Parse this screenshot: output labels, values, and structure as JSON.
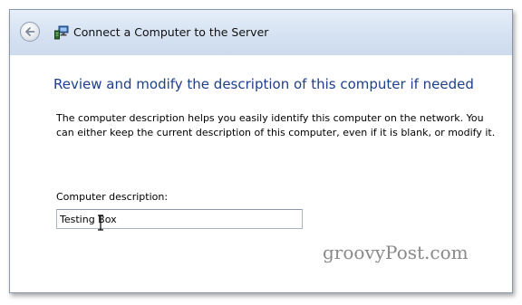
{
  "window": {
    "title": "Connect a Computer to the Server",
    "icons": {
      "back": "back-arrow-icon",
      "app": "network-computer-icon"
    }
  },
  "page": {
    "heading": "Review and modify the description of this computer if needed",
    "description": "The computer description helps you easily identify this computer on the network. You can either keep the current description of this computer, even if it is blank, or modify it."
  },
  "form": {
    "field_label": "Computer description:",
    "field_value": "Testing Box"
  },
  "watermark": "groovyPost.com",
  "colors": {
    "heading": "#1e3f8a",
    "titlebar": "#d6e2f2"
  }
}
